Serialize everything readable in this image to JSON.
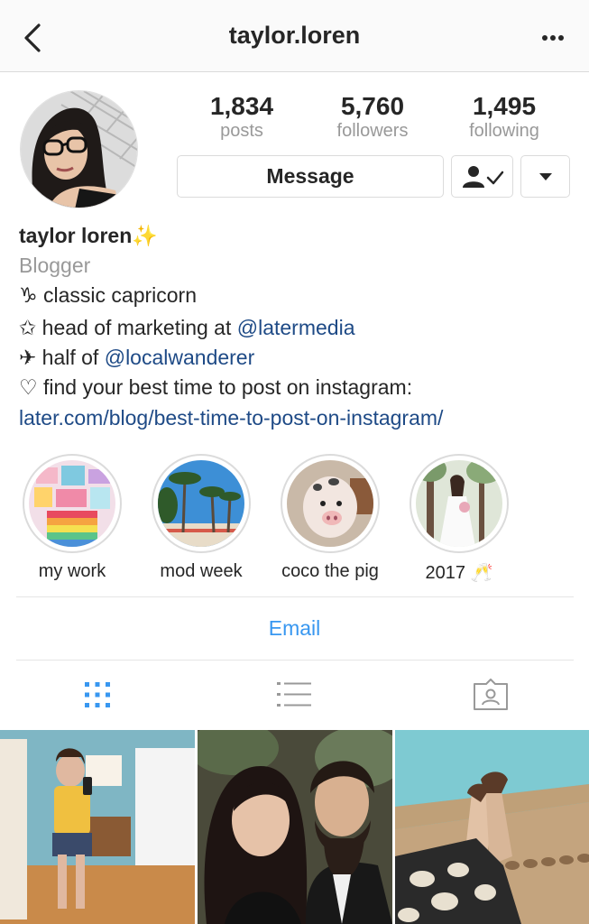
{
  "header": {
    "title": "taylor.loren"
  },
  "stats": {
    "posts": {
      "count": "1,834",
      "label": "posts"
    },
    "followers": {
      "count": "5,760",
      "label": "followers"
    },
    "following": {
      "count": "1,495",
      "label": "following"
    }
  },
  "actions": {
    "message_label": "Message"
  },
  "bio": {
    "name": "taylor loren",
    "name_emoji": "✨",
    "category": "Blogger",
    "line1": "♑ classic capricorn",
    "line2_prefix": "✩ head of marketing at ",
    "line2_mention": "@latermedia",
    "line3_prefix": "✈ half of ",
    "line3_mention": "@localwanderer",
    "line4": "♡ find your best time to post on instagram:",
    "website": "later.com/blog/best-time-to-post-on-instagram/"
  },
  "highlights": [
    {
      "label": "my work"
    },
    {
      "label": "mod week"
    },
    {
      "label": "coco the pig"
    },
    {
      "label": "2017 🥂"
    }
  ],
  "contact": {
    "email_label": "Email"
  },
  "tabs": {
    "active": "grid",
    "items": [
      "grid",
      "list",
      "tagged"
    ]
  },
  "icons": {
    "back": "chevron-left-icon",
    "more": "more-horizontal-icon",
    "following": "person-check-icon",
    "dropdown": "triangle-down-icon",
    "grid": "grid-icon",
    "list": "list-icon",
    "tagged": "tagged-person-icon"
  },
  "colors": {
    "link": "#1e4a86",
    "email": "#3897f0",
    "active_tab": "#3897f0",
    "inactive_tab": "#999999"
  }
}
